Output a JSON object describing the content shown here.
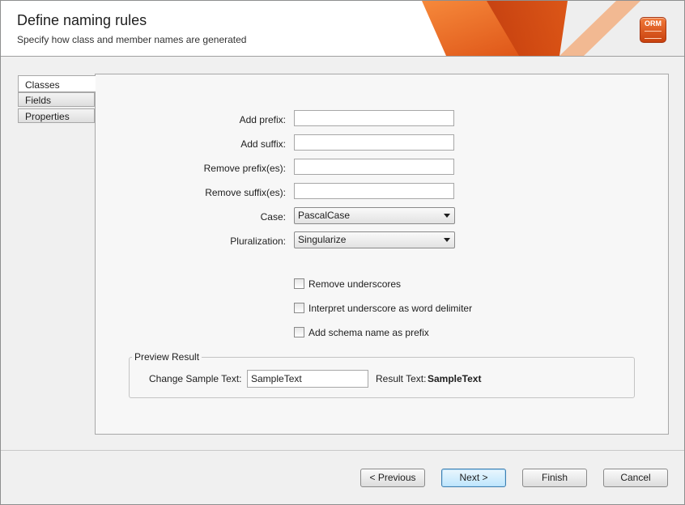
{
  "header": {
    "title": "Define naming rules",
    "subtitle": "Specify how class and member names are generated",
    "logo_text": "ORM",
    "accent_color": "#e8621a"
  },
  "tabs": [
    {
      "label": "Classes",
      "active": true
    },
    {
      "label": "Fields",
      "active": false
    },
    {
      "label": "Properties",
      "active": false
    }
  ],
  "form": {
    "add_prefix": {
      "label": "Add prefix:",
      "value": ""
    },
    "add_suffix": {
      "label": "Add suffix:",
      "value": ""
    },
    "remove_prefixes": {
      "label": "Remove prefix(es):",
      "value": ""
    },
    "remove_suffixes": {
      "label": "Remove suffix(es):",
      "value": ""
    },
    "case": {
      "label": "Case:",
      "value": "PascalCase"
    },
    "pluralization": {
      "label": "Pluralization:",
      "value": "Singularize"
    },
    "checks": {
      "remove_underscores": {
        "label": "Remove underscores",
        "checked": false
      },
      "underscore_delimiter": {
        "label": "Interpret underscore as word delimiter",
        "checked": false
      },
      "schema_prefix": {
        "label": "Add schema name as prefix",
        "checked": false
      }
    }
  },
  "preview": {
    "legend": "Preview Result",
    "sample_label": "Change Sample Text:",
    "sample_value": "SampleText",
    "result_label": "Result Text:",
    "result_value": "SampleText"
  },
  "buttons": {
    "previous": "< Previous",
    "next": "Next >",
    "finish": "Finish",
    "cancel": "Cancel"
  }
}
